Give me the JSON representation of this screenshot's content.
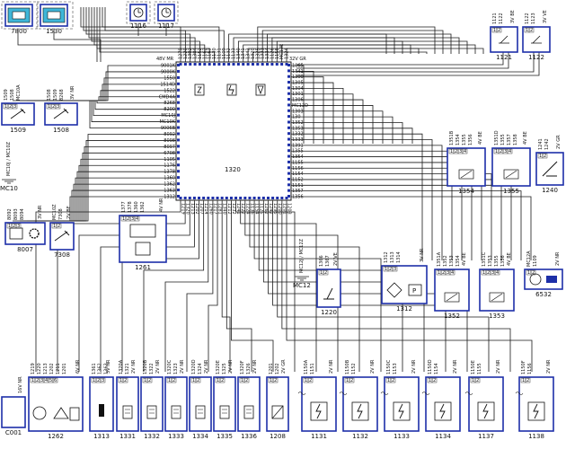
{
  "ecu": {
    "ref": "1320",
    "connector_label": "32V GR",
    "left_connector": "48V MR",
    "left_pins": [
      "9001K",
      "9000K",
      "1550",
      "1514D",
      "1522",
      "CMD4A",
      "8268",
      "8200",
      "MC10J",
      "MC10K",
      "9006B",
      "8092",
      "8098",
      "8097",
      "6708",
      "1105",
      "1176",
      "1378",
      "1360",
      "1362",
      "1363",
      "1312"
    ],
    "right_pins": [
      "1065",
      "1341",
      "1300",
      "1305",
      "1304",
      "1301",
      "1306",
      "MC12D",
      "1303",
      "130",
      "1352",
      "1353",
      "1332",
      "1333",
      "1391",
      "1355",
      "1354",
      "1155",
      "1156",
      "1154",
      "1152",
      "1151",
      "1357",
      "1356"
    ],
    "top_pins": [
      "1279",
      "1220",
      "1302",
      "1304",
      "1152",
      "1162",
      "1163",
      "1130",
      "1131",
      "1109",
      "1132",
      "1133",
      "1340",
      "1341",
      "1342",
      "1320",
      "1325",
      "1331",
      "1334",
      "1126",
      "1158",
      "MC12E",
      "1324"
    ],
    "bottom_pins": [
      "1219",
      "1320",
      "1213",
      "1202",
      "1207",
      "1214",
      "1260",
      "1217",
      "1281",
      "1340",
      "1212",
      "1232",
      "1241",
      "1222",
      "1224",
      "1136",
      "1154",
      "1125",
      "1262",
      "1242",
      "1295",
      "1200",
      "1201",
      "1203"
    ]
  },
  "components": [
    {
      "ref": "7800",
      "spec": "",
      "pins": []
    },
    {
      "ref": "1530",
      "spec": "",
      "pins": []
    },
    {
      "ref": "1116",
      "spec": "",
      "pins": []
    },
    {
      "ref": "1117",
      "spec": "",
      "pins": []
    },
    {
      "ref": "1121",
      "spec": "3V BE",
      "pins": [
        "1",
        "2"
      ]
    },
    {
      "ref": "1122",
      "spec": "3V VE",
      "pins": [
        "1",
        "2"
      ]
    },
    {
      "ref": "1509",
      "spec": "",
      "pins": [
        "1",
        "2",
        "3"
      ]
    },
    {
      "ref": "1508",
      "spec": "3V NR",
      "pins": [
        "1",
        "2",
        "3"
      ]
    },
    {
      "ref": "1354",
      "spec": "4V BE",
      "pins": [
        "1",
        "2",
        "3",
        "4"
      ]
    },
    {
      "ref": "1355",
      "spec": "4V BE",
      "pins": [
        "1",
        "2",
        "3",
        "4"
      ]
    },
    {
      "ref": "1240",
      "spec": "2V GR",
      "pins": [
        "1",
        "2"
      ]
    },
    {
      "ref": "8007",
      "spec": "3V NR",
      "pins": [
        "1",
        "2",
        "3"
      ]
    },
    {
      "ref": "7308",
      "spec": "2V BE",
      "pins": [
        "1",
        "2"
      ]
    },
    {
      "ref": "1261",
      "spec": "4V NR",
      "pins": [
        "1",
        "2",
        "3",
        "4"
      ]
    },
    {
      "ref": "1220",
      "spec": "2V VE",
      "pins": [
        "1",
        "2"
      ]
    },
    {
      "ref": "1312",
      "spec": "3V NR",
      "pins": [
        "1",
        "2",
        "3"
      ]
    },
    {
      "ref": "1352",
      "spec": "4V BE",
      "pins": [
        "1",
        "2",
        "3",
        "4"
      ]
    },
    {
      "ref": "1353",
      "spec": "4V BE",
      "pins": [
        "1",
        "2",
        "3",
        "4"
      ]
    },
    {
      "ref": "6532",
      "spec": "2V NR",
      "pins": [
        "1",
        "2"
      ]
    },
    {
      "ref": "C001",
      "spec": "16V NR",
      "pins": []
    },
    {
      "ref": "1262",
      "spec": "6V NR",
      "pins": [
        "1",
        "2",
        "3",
        "4",
        "5",
        "6"
      ]
    },
    {
      "ref": "1313",
      "spec": "3V NR",
      "pins": [
        "1",
        "2",
        "3"
      ]
    },
    {
      "ref": "1331",
      "spec": "2V NR",
      "pins": [
        "1",
        "2"
      ]
    },
    {
      "ref": "1332",
      "spec": "2V NR",
      "pins": [
        "1",
        "2"
      ]
    },
    {
      "ref": "1333",
      "spec": "2V NR",
      "pins": [
        "1",
        "2"
      ]
    },
    {
      "ref": "1334",
      "spec": "2V NR",
      "pins": [
        "1",
        "2"
      ]
    },
    {
      "ref": "1335",
      "spec": "2V NR",
      "pins": [
        "1",
        "2"
      ]
    },
    {
      "ref": "1336",
      "spec": "2V NR",
      "pins": [
        "1",
        "2"
      ]
    },
    {
      "ref": "1208",
      "spec": "2V GR",
      "pins": [
        "1",
        "2"
      ]
    },
    {
      "ref": "1131",
      "spec": "2V NR",
      "pins": [
        "1",
        "2"
      ]
    },
    {
      "ref": "1132",
      "spec": "2V NR",
      "pins": [
        "1",
        "2"
      ]
    },
    {
      "ref": "1133",
      "spec": "2V NR",
      "pins": [
        "1",
        "2"
      ]
    },
    {
      "ref": "1134",
      "spec": "2V NR",
      "pins": [
        "1",
        "2"
      ]
    },
    {
      "ref": "1137",
      "spec": "2V NR",
      "pins": [
        "1",
        "2"
      ]
    },
    {
      "ref": "1138",
      "spec": "2V NR",
      "pins": [
        "1",
        "2"
      ]
    }
  ],
  "grounds": [
    "MC10",
    "MC12"
  ],
  "ground_wires": [
    "MC10J / MC10Z",
    "MC12J / MC12Z"
  ],
  "wire_labels": {
    "w1509": [
      "1509",
      "1508",
      "MC10A"
    ],
    "w1508": [
      "1508",
      "1509",
      "8268"
    ],
    "w8007": [
      "8092",
      "8093",
      "8094"
    ],
    "w7308": [
      "MC10Z",
      "7308"
    ],
    "w1261": [
      "1377",
      "1378",
      "1360",
      "1362"
    ],
    "w1220": [
      "1366",
      "1367"
    ],
    "w1312": [
      "1312",
      "1313",
      "1314"
    ],
    "w1352": [
      "1351A",
      "1352",
      "1353",
      "1354"
    ],
    "w1353": [
      "1351C",
      "1353",
      "1355",
      "1356"
    ],
    "w6532": [
      "MC12A",
      "1109"
    ],
    "w1354": [
      "1351B",
      "1354",
      "1355",
      "1356"
    ],
    "w1355": [
      "1351D",
      "1355",
      "1357",
      "1358"
    ],
    "w1240": [
      "1241",
      "1242"
    ],
    "w1121": [
      "1121",
      "1122"
    ],
    "w1122": [
      "1122",
      "1123"
    ],
    "w1262": [
      "1219",
      "1220",
      "1213",
      "1202",
      "1211",
      "1201"
    ],
    "w1313": [
      "1361",
      "1362",
      "1363"
    ],
    "w1331": [
      "1320A",
      "1321"
    ],
    "w1332": [
      "1320B",
      "1322"
    ],
    "w1333": [
      "1320C",
      "1323"
    ],
    "w1334": [
      "1320D",
      "1324"
    ],
    "w1335": [
      "1320E",
      "1325"
    ],
    "w1336": [
      "1320F",
      "1326"
    ],
    "w1208": [
      "1201",
      "1202"
    ],
    "w1131": [
      "1150A",
      "1151"
    ],
    "w1132": [
      "1150B",
      "1152"
    ],
    "w1133": [
      "1150C",
      "1153"
    ],
    "w1134": [
      "1150D",
      "1154"
    ],
    "w1137": [
      "1150E",
      "1155"
    ],
    "w1138": [
      "1150F",
      "1156"
    ]
  },
  "colors": {
    "component_border": "#1d2fa8",
    "wire": "#1a1a1a",
    "background": "#ffffff",
    "relay_highlight": "#3fb6d8"
  }
}
